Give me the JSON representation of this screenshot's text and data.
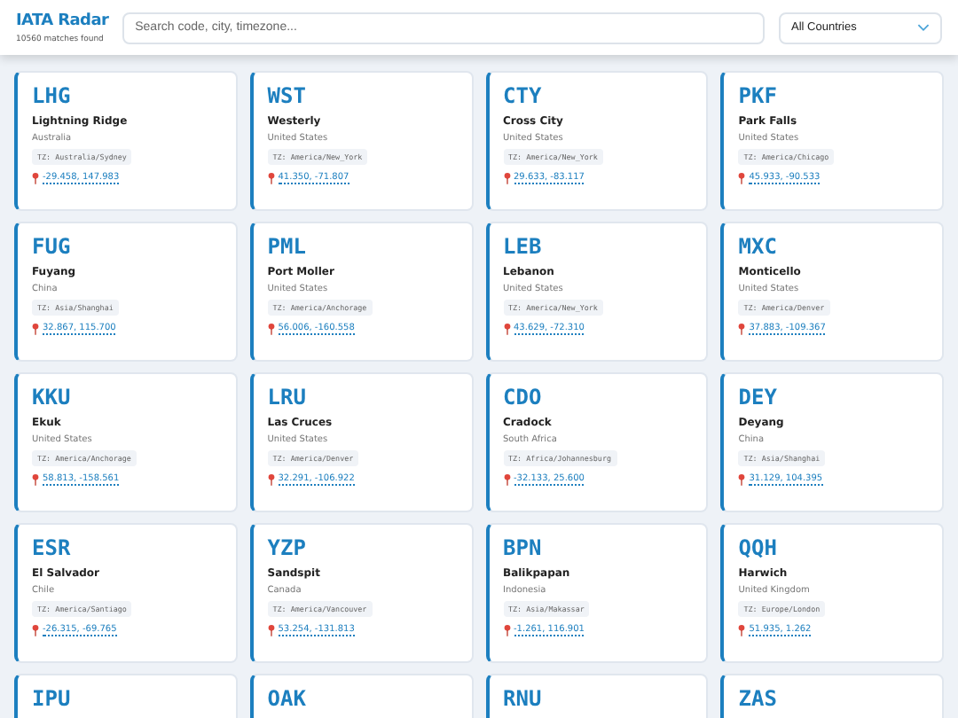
{
  "header": {
    "title": "IATA Radar",
    "subtitle": "10560 matches found",
    "search": {
      "placeholder": "Search code, city, timezone..."
    },
    "country_filter": {
      "value": "All Countries"
    }
  },
  "airports": [
    {
      "code": "LHG",
      "city": "Lightning Ridge",
      "country": "Australia",
      "timezone": "TZ: Australia/Sydney",
      "coords": "-29.458, 147.983"
    },
    {
      "code": "WST",
      "city": "Westerly",
      "country": "United States",
      "timezone": "TZ: America/New_York",
      "coords": "41.350, -71.807"
    },
    {
      "code": "CTY",
      "city": "Cross City",
      "country": "United States",
      "timezone": "TZ: America/New_York",
      "coords": "29.633, -83.117"
    },
    {
      "code": "PKF",
      "city": "Park Falls",
      "country": "United States",
      "timezone": "TZ: America/Chicago",
      "coords": "45.933, -90.533"
    },
    {
      "code": "FUG",
      "city": "Fuyang",
      "country": "China",
      "timezone": "TZ: Asia/Shanghai",
      "coords": "32.867, 115.700"
    },
    {
      "code": "PML",
      "city": "Port Moller",
      "country": "United States",
      "timezone": "TZ: America/Anchorage",
      "coords": "56.006, -160.558"
    },
    {
      "code": "LEB",
      "city": "Lebanon",
      "country": "United States",
      "timezone": "TZ: America/New_York",
      "coords": "43.629, -72.310"
    },
    {
      "code": "MXC",
      "city": "Monticello",
      "country": "United States",
      "timezone": "TZ: America/Denver",
      "coords": "37.883, -109.367"
    },
    {
      "code": "KKU",
      "city": "Ekuk",
      "country": "United States",
      "timezone": "TZ: America/Anchorage",
      "coords": "58.813, -158.561"
    },
    {
      "code": "LRU",
      "city": "Las Cruces",
      "country": "United States",
      "timezone": "TZ: America/Denver",
      "coords": "32.291, -106.922"
    },
    {
      "code": "CDO",
      "city": "Cradock",
      "country": "South Africa",
      "timezone": "TZ: Africa/Johannesburg",
      "coords": "-32.133, 25.600"
    },
    {
      "code": "DEY",
      "city": "Deyang",
      "country": "China",
      "timezone": "TZ: Asia/Shanghai",
      "coords": "31.129, 104.395"
    },
    {
      "code": "ESR",
      "city": "El Salvador",
      "country": "Chile",
      "timezone": "TZ: America/Santiago",
      "coords": "-26.315, -69.765"
    },
    {
      "code": "YZP",
      "city": "Sandspit",
      "country": "Canada",
      "timezone": "TZ: America/Vancouver",
      "coords": "53.254, -131.813"
    },
    {
      "code": "BPN",
      "city": "Balikpapan",
      "country": "Indonesia",
      "timezone": "TZ: Asia/Makassar",
      "coords": "-1.261, 116.901"
    },
    {
      "code": "QQH",
      "city": "Harwich",
      "country": "United Kingdom",
      "timezone": "TZ: Europe/London",
      "coords": "51.935, 1.262"
    },
    {
      "code": "IPU"
    },
    {
      "code": "OAK"
    },
    {
      "code": "RNU"
    },
    {
      "code": "ZAS"
    }
  ]
}
